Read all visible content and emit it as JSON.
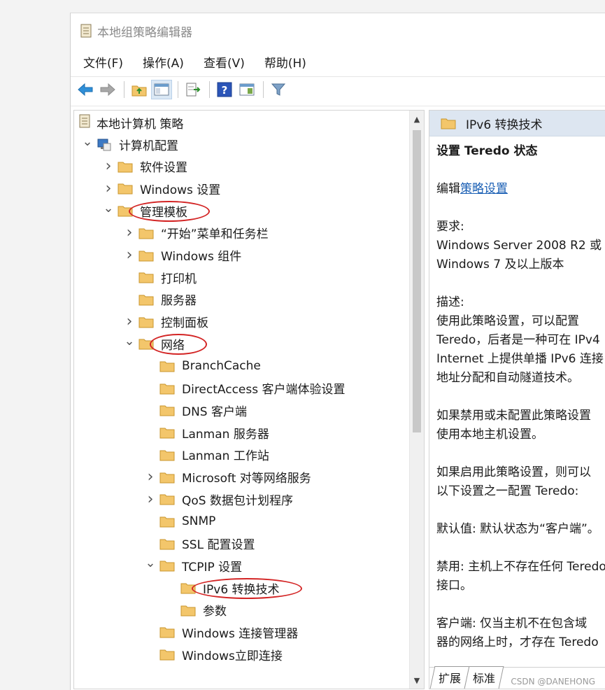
{
  "window": {
    "title": "本地组策略编辑器"
  },
  "menu": [
    "文件(F)",
    "操作(A)",
    "查看(V)",
    "帮助(H)"
  ],
  "toolbar": [
    {
      "name": "back-icon"
    },
    {
      "name": "forward-icon"
    },
    {
      "name": "up-folder-icon"
    },
    {
      "name": "show-hide-tree-icon",
      "active": true
    },
    {
      "name": "export-list-icon"
    },
    {
      "name": "help-icon"
    },
    {
      "name": "console-tree-icon"
    },
    {
      "name": "filter-icon"
    }
  ],
  "tree": {
    "root": "本地计算机 策略",
    "items": [
      {
        "label": "计算机配置",
        "level": 1,
        "arrow": "down",
        "type": "computer"
      },
      {
        "label": "软件设置",
        "level": 2,
        "arrow": "right"
      },
      {
        "label": "Windows 设置",
        "level": 2,
        "arrow": "right"
      },
      {
        "label": "管理模板",
        "level": 2,
        "arrow": "down",
        "circled": true
      },
      {
        "label": "“开始”菜单和任务栏",
        "level": 3,
        "arrow": "right"
      },
      {
        "label": "Windows 组件",
        "level": 3,
        "arrow": "right"
      },
      {
        "label": "打印机",
        "level": 3,
        "arrow": ""
      },
      {
        "label": "服务器",
        "level": 3,
        "arrow": ""
      },
      {
        "label": "控制面板",
        "level": 3,
        "arrow": "right"
      },
      {
        "label": "网络",
        "level": 3,
        "arrow": "down",
        "circled": true
      },
      {
        "label": "BranchCache",
        "level": 4,
        "arrow": ""
      },
      {
        "label": "DirectAccess 客户端体验设置",
        "level": 4,
        "arrow": ""
      },
      {
        "label": "DNS 客户端",
        "level": 4,
        "arrow": ""
      },
      {
        "label": "Lanman 服务器",
        "level": 4,
        "arrow": ""
      },
      {
        "label": "Lanman 工作站",
        "level": 4,
        "arrow": ""
      },
      {
        "label": "Microsoft 对等网络服务",
        "level": 4,
        "arrow": "right"
      },
      {
        "label": "QoS 数据包计划程序",
        "level": 4,
        "arrow": "right"
      },
      {
        "label": "SNMP",
        "level": 4,
        "arrow": ""
      },
      {
        "label": "SSL 配置设置",
        "level": 4,
        "arrow": ""
      },
      {
        "label": "TCPIP 设置",
        "level": 4,
        "arrow": "down"
      },
      {
        "label": "IPv6 转换技术",
        "level": 5,
        "arrow": "",
        "circled": true,
        "selected": true
      },
      {
        "label": "参数",
        "level": 5,
        "arrow": ""
      },
      {
        "label": "Windows 连接管理器",
        "level": 4,
        "arrow": ""
      },
      {
        "label": "Windows立即连接",
        "level": 4,
        "arrow": ""
      }
    ]
  },
  "detail": {
    "header": "IPv6 转换技术",
    "setting_title": "设置 Teredo 状态",
    "edit_prefix": "编辑",
    "edit_link": "策略设置",
    "requirements_label": "要求:",
    "requirements_lines": [
      "Windows Server 2008 R2 或",
      "Windows 7 及以上版本"
    ],
    "description_label": "描述:",
    "description_lines": [
      "使用此策略设置，可以配置",
      "Teredo，后者是一种可在 IPv4",
      "Internet 上提供单播 IPv6 连接",
      "地址分配和自动隧道技术。"
    ],
    "para2_lines": [
      "如果禁用或未配置此策略设置",
      "使用本地主机设置。"
    ],
    "para3_lines": [
      "如果启用此策略设置，则可以",
      "以下设置之一配置 Teredo:"
    ],
    "para4_lines": [
      "默认值: 默认状态为“客户端”。"
    ],
    "para5_lines": [
      "禁用: 主机上不存在任何 Teredo",
      "接口。"
    ],
    "para6_lines": [
      "客户端: 仅当主机不在包含域",
      "器的网络上时，才存在 Teredo"
    ]
  },
  "tabs": [
    "扩展",
    "标准"
  ],
  "watermark": "CSDN @DANEHONG",
  "colors": {
    "circle": "#d32424",
    "link": "#1a5fb4",
    "folder": "#f3c66b",
    "header_bg": "#dde6f1"
  }
}
